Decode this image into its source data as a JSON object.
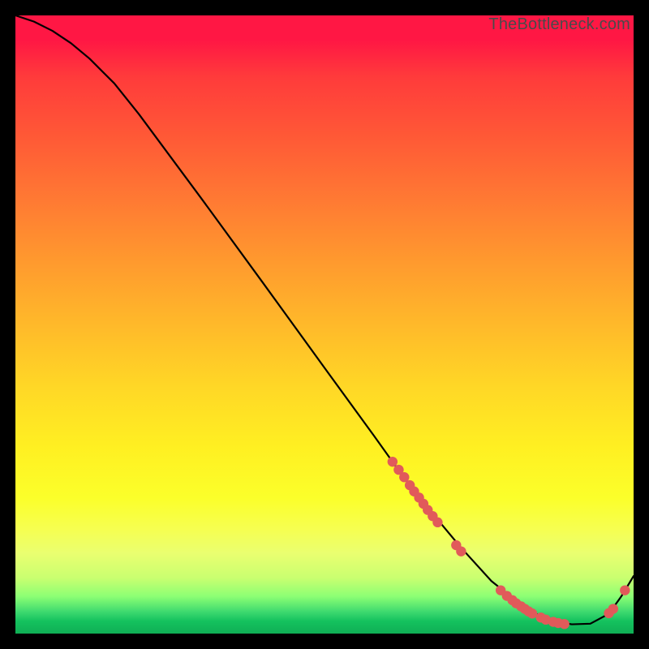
{
  "watermark": "TheBottleneck.com",
  "chart_data": {
    "type": "line",
    "title": "",
    "xlabel": "",
    "ylabel": "",
    "xlim": [
      0,
      100
    ],
    "ylim": [
      0,
      100
    ],
    "line": {
      "x": [
        0,
        3,
        6,
        9,
        12,
        16,
        20,
        30,
        40,
        50,
        58,
        63,
        67,
        72,
        77,
        82,
        86,
        90,
        93,
        96,
        98,
        100
      ],
      "y": [
        100,
        99,
        97.5,
        95.5,
        93,
        89,
        84,
        70.5,
        56.8,
        43,
        32,
        25,
        20,
        14,
        8.5,
        4.5,
        2.2,
        1.5,
        1.6,
        3.2,
        6,
        9.3
      ]
    },
    "marker_clusters": [
      {
        "label": "descent-cluster",
        "color": "#e15a5a",
        "points": [
          {
            "x": 61,
            "y": 27.8
          },
          {
            "x": 62,
            "y": 26.5
          },
          {
            "x": 62.9,
            "y": 25.3
          },
          {
            "x": 63.8,
            "y": 24.0
          },
          {
            "x": 64.5,
            "y": 23.0
          },
          {
            "x": 65.3,
            "y": 22.0
          },
          {
            "x": 66.0,
            "y": 21.0
          },
          {
            "x": 66.7,
            "y": 20.0
          },
          {
            "x": 67.5,
            "y": 19.0
          },
          {
            "x": 68.3,
            "y": 18.0
          }
        ]
      },
      {
        "label": "mid-pair",
        "color": "#e15a5a",
        "points": [
          {
            "x": 71.3,
            "y": 14.3
          },
          {
            "x": 72.1,
            "y": 13.3
          }
        ]
      },
      {
        "label": "bottom-cluster",
        "color": "#e15a5a",
        "points": [
          {
            "x": 78.5,
            "y": 7.0
          },
          {
            "x": 79.5,
            "y": 6.1
          },
          {
            "x": 80.4,
            "y": 5.4
          },
          {
            "x": 81.0,
            "y": 4.9
          },
          {
            "x": 81.8,
            "y": 4.4
          },
          {
            "x": 82.4,
            "y": 4.0
          },
          {
            "x": 83.0,
            "y": 3.6
          },
          {
            "x": 83.6,
            "y": 3.25
          },
          {
            "x": 85.0,
            "y": 2.6
          },
          {
            "x": 85.8,
            "y": 2.25
          },
          {
            "x": 87.0,
            "y": 1.9
          },
          {
            "x": 87.8,
            "y": 1.72
          },
          {
            "x": 88.8,
            "y": 1.55
          }
        ]
      },
      {
        "label": "rise-pair",
        "color": "#e15a5a",
        "points": [
          {
            "x": 96.0,
            "y": 3.3
          },
          {
            "x": 96.7,
            "y": 4.0
          }
        ]
      },
      {
        "label": "rise-single",
        "color": "#e15a5a",
        "points": [
          {
            "x": 98.6,
            "y": 7.0
          }
        ]
      }
    ]
  }
}
